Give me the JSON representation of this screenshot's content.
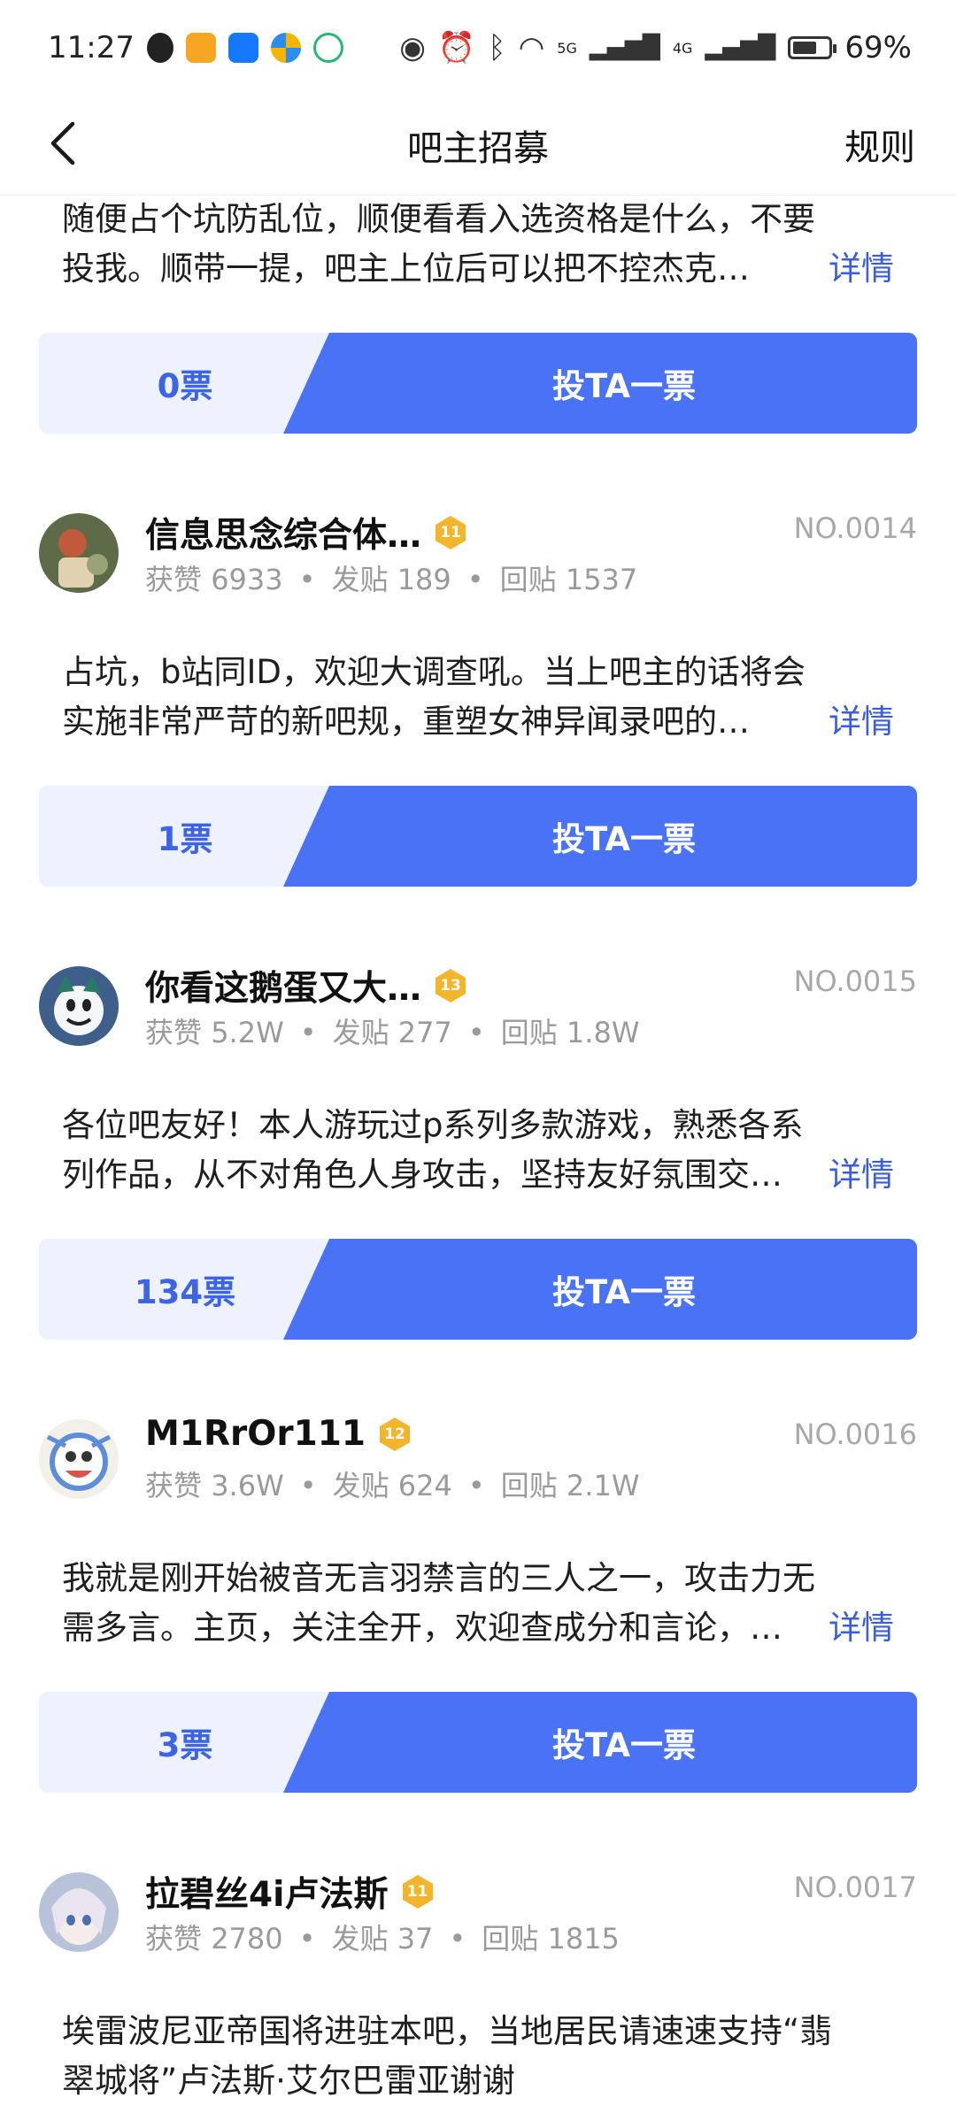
{
  "status_bar": {
    "time": "11:27",
    "battery": "69%",
    "battery_level": 0.69,
    "app_icons": [
      "qq-icon",
      "taobao-icon",
      "alipay-icon",
      "pinwheel-icon",
      "security-icon"
    ],
    "signal_labels": [
      "5G",
      "4G"
    ]
  },
  "nav": {
    "title": "吧主招募",
    "rules": "规则"
  },
  "vote_label": "投TA一票",
  "detail_label": "详情",
  "stat_labels": {
    "likes": "获赞",
    "posts": "发贴",
    "replies": "回贴"
  },
  "candidates": [
    {
      "desc_line1": "随便占个坑防乱位，顺便看看入选资格是什么，不要",
      "desc_line2": "投我。顺带一提，吧主上位后可以把不控杰克…",
      "votes": "0票"
    },
    {
      "name": "信息思念综合体…",
      "level": "11",
      "no": "NO.0014",
      "likes": "6933",
      "posts": "189",
      "replies": "1537",
      "desc_line1": "占坑，b站同ID，欢迎大调查吼。当上吧主的话将会",
      "desc_line2": "实施非常严苛的新吧规，重塑女神异闻录吧的…",
      "votes": "1票",
      "avatar_colors": [
        "#6b7a4e",
        "#c05a3a"
      ]
    },
    {
      "name": "你看这鹅蛋又大…",
      "level": "13",
      "no": "NO.0015",
      "likes": "5.2W",
      "posts": "277",
      "replies": "1.8W",
      "desc_line1": "各位吧友好！本人游玩过p系列多款游戏，熟悉各系",
      "desc_line2": "列作品，从不对角色人身攻击，坚持友好氛围交…",
      "votes": "134票",
      "avatar_colors": [
        "#3d5f8a",
        "#ffffff"
      ]
    },
    {
      "name": "M1RrOr111",
      "level": "12",
      "no": "NO.0016",
      "likes": "3.6W",
      "posts": "624",
      "replies": "2.1W",
      "desc_line1": "我就是刚开始被音无言羽禁言的三人之一，攻击力无",
      "desc_line2": "需多言。主页，关注全开，欢迎查成分和言论，…",
      "votes": "3票",
      "avatar_colors": [
        "#5f8ed8",
        "#f3f0ea"
      ]
    },
    {
      "name": "拉碧丝4i卢法斯",
      "level": "11",
      "no": "NO.0017",
      "likes": "2780",
      "posts": "37",
      "replies": "1815",
      "desc_line1": "埃雷波尼亚帝国将进驻本吧，当地居民请速速支持“翡",
      "desc_line2": "翠城将”卢法斯·艾尔巴雷亚谢谢",
      "avatar_colors": [
        "#b8c2d8",
        "#e9e4f0"
      ]
    }
  ]
}
